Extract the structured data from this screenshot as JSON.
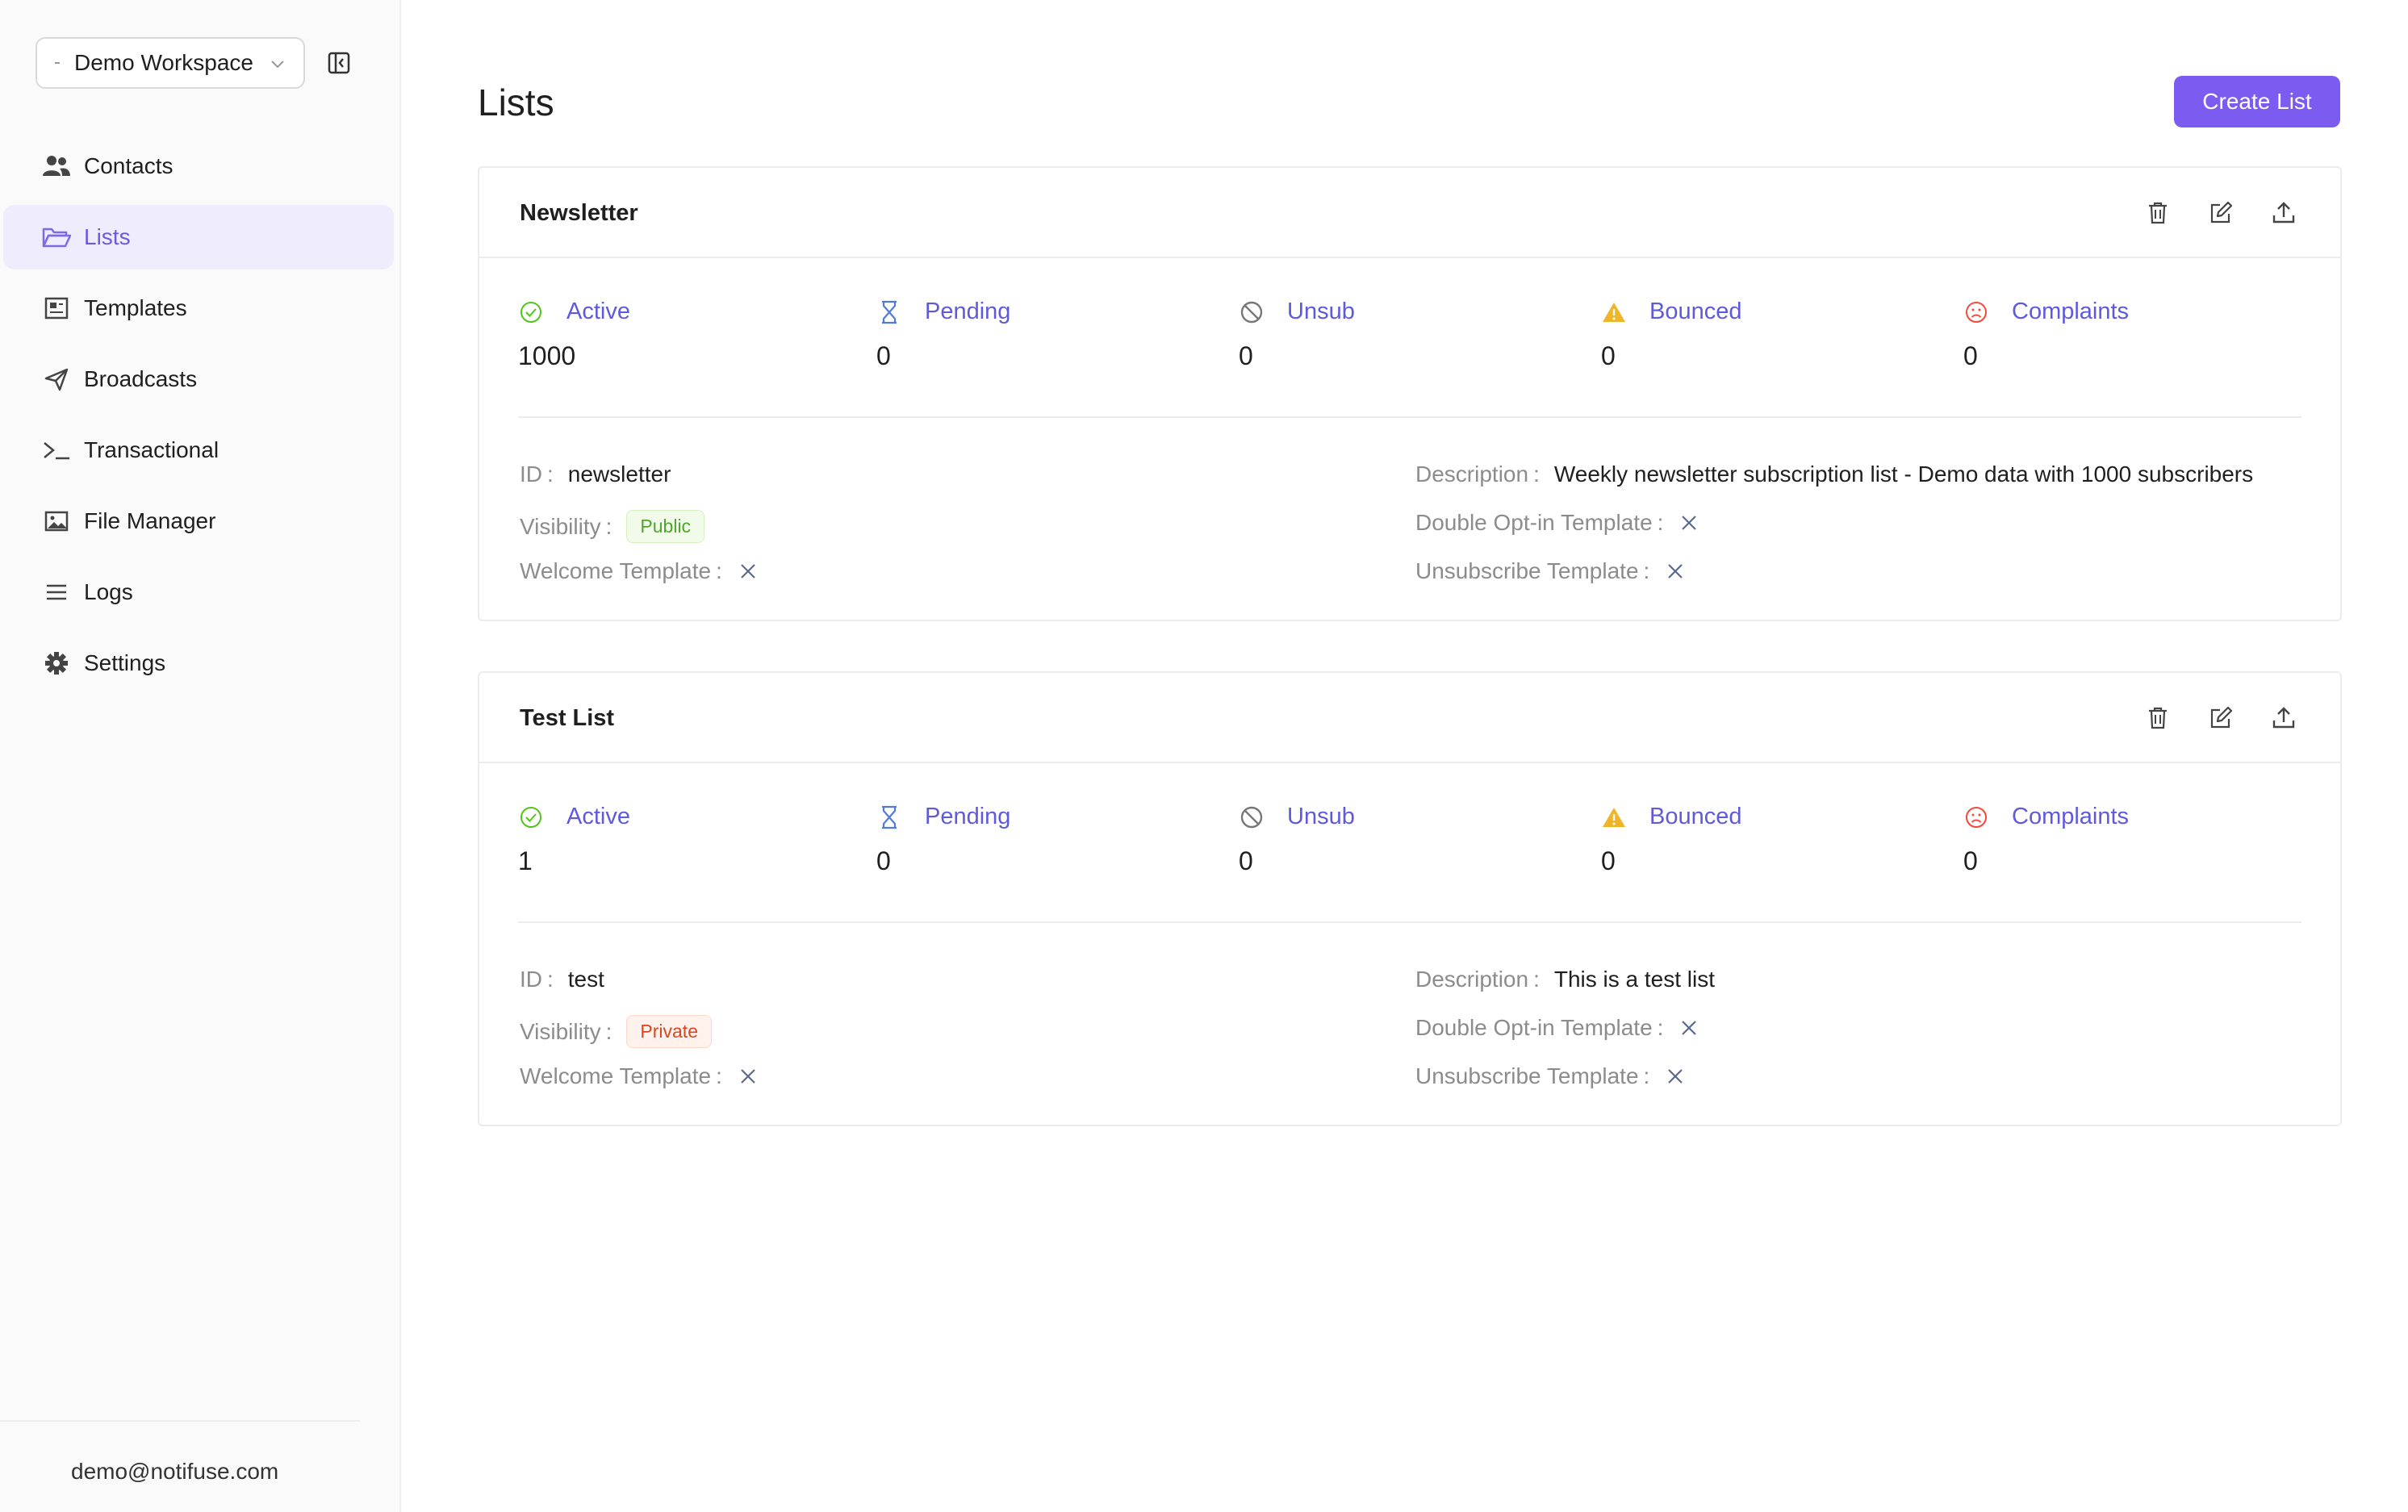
{
  "sidebar": {
    "workspace": "Demo Workspace",
    "items": [
      {
        "label": "Contacts",
        "icon": "users-icon",
        "active": false
      },
      {
        "label": "Lists",
        "icon": "folder-open-icon",
        "active": true
      },
      {
        "label": "Templates",
        "icon": "templates-icon",
        "active": false
      },
      {
        "label": "Broadcasts",
        "icon": "send-icon",
        "active": false
      },
      {
        "label": "Transactional",
        "icon": "terminal-icon",
        "active": false
      },
      {
        "label": "File Manager",
        "icon": "image-icon",
        "active": false
      },
      {
        "label": "Logs",
        "icon": "list-icon",
        "active": false
      },
      {
        "label": "Settings",
        "icon": "gear-icon",
        "active": false
      }
    ],
    "user_email": "demo@notifuse.com"
  },
  "page": {
    "title": "Lists",
    "create_label": "Create List"
  },
  "stat_labels": {
    "active": "Active",
    "pending": "Pending",
    "unsub": "Unsub",
    "bounced": "Bounced",
    "complaints": "Complaints"
  },
  "detail_labels": {
    "id": "ID",
    "visibility": "Visibility",
    "welcome": "Welcome Template",
    "description": "Description",
    "double_optin": "Double Opt-in Template",
    "unsubscribe": "Unsubscribe Template",
    "separator": ":"
  },
  "lists": [
    {
      "name": "Newsletter",
      "stats": {
        "active": "1000",
        "pending": "0",
        "unsub": "0",
        "bounced": "0",
        "complaints": "0"
      },
      "id": "newsletter",
      "visibility": "Public",
      "description": "Weekly newsletter subscription list - Demo data with 1000 subscribers"
    },
    {
      "name": "Test List",
      "stats": {
        "active": "1",
        "pending": "0",
        "unsub": "0",
        "bounced": "0",
        "complaints": "0"
      },
      "id": "test",
      "visibility": "Private",
      "description": "This is a test list"
    }
  ],
  "colors": {
    "accent": "#7c5cf0",
    "stat_label": "#5f5ad9",
    "active_icon": "#52c41a",
    "pending_icon": "#4f7bdc",
    "bounced_icon": "#f0b429",
    "complaints_icon": "#f5483b"
  }
}
